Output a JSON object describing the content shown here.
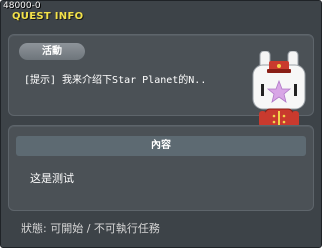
{
  "window": {
    "id_label": "48000-0",
    "title": "QUEST INFO"
  },
  "quest": {
    "category_tag": "活動",
    "name": "[提示] 我来介绍下Star Planet的N..",
    "npc_icon": "bunny-bellhop-npc"
  },
  "content": {
    "header": "內容",
    "body": "这是测试"
  },
  "status": {
    "text": "狀態: 可開始 / 不可執行任務"
  },
  "colors": {
    "title": "#f3e24a",
    "background": "#3d4348",
    "panel": "#4b5156",
    "header_bar": "#5d6a72"
  }
}
